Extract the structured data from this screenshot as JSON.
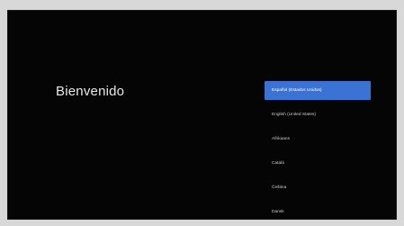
{
  "welcome": {
    "title": "Bienvenido"
  },
  "languages": {
    "items": [
      "Español (Estados Unidos)",
      "English (United States)",
      "Afrikaans",
      "Català",
      "Čeština",
      "Dansk"
    ],
    "selected_index": 0
  },
  "colors": {
    "background": "#050505",
    "accent": "#3a73d4",
    "text": "#e8e8e8"
  }
}
